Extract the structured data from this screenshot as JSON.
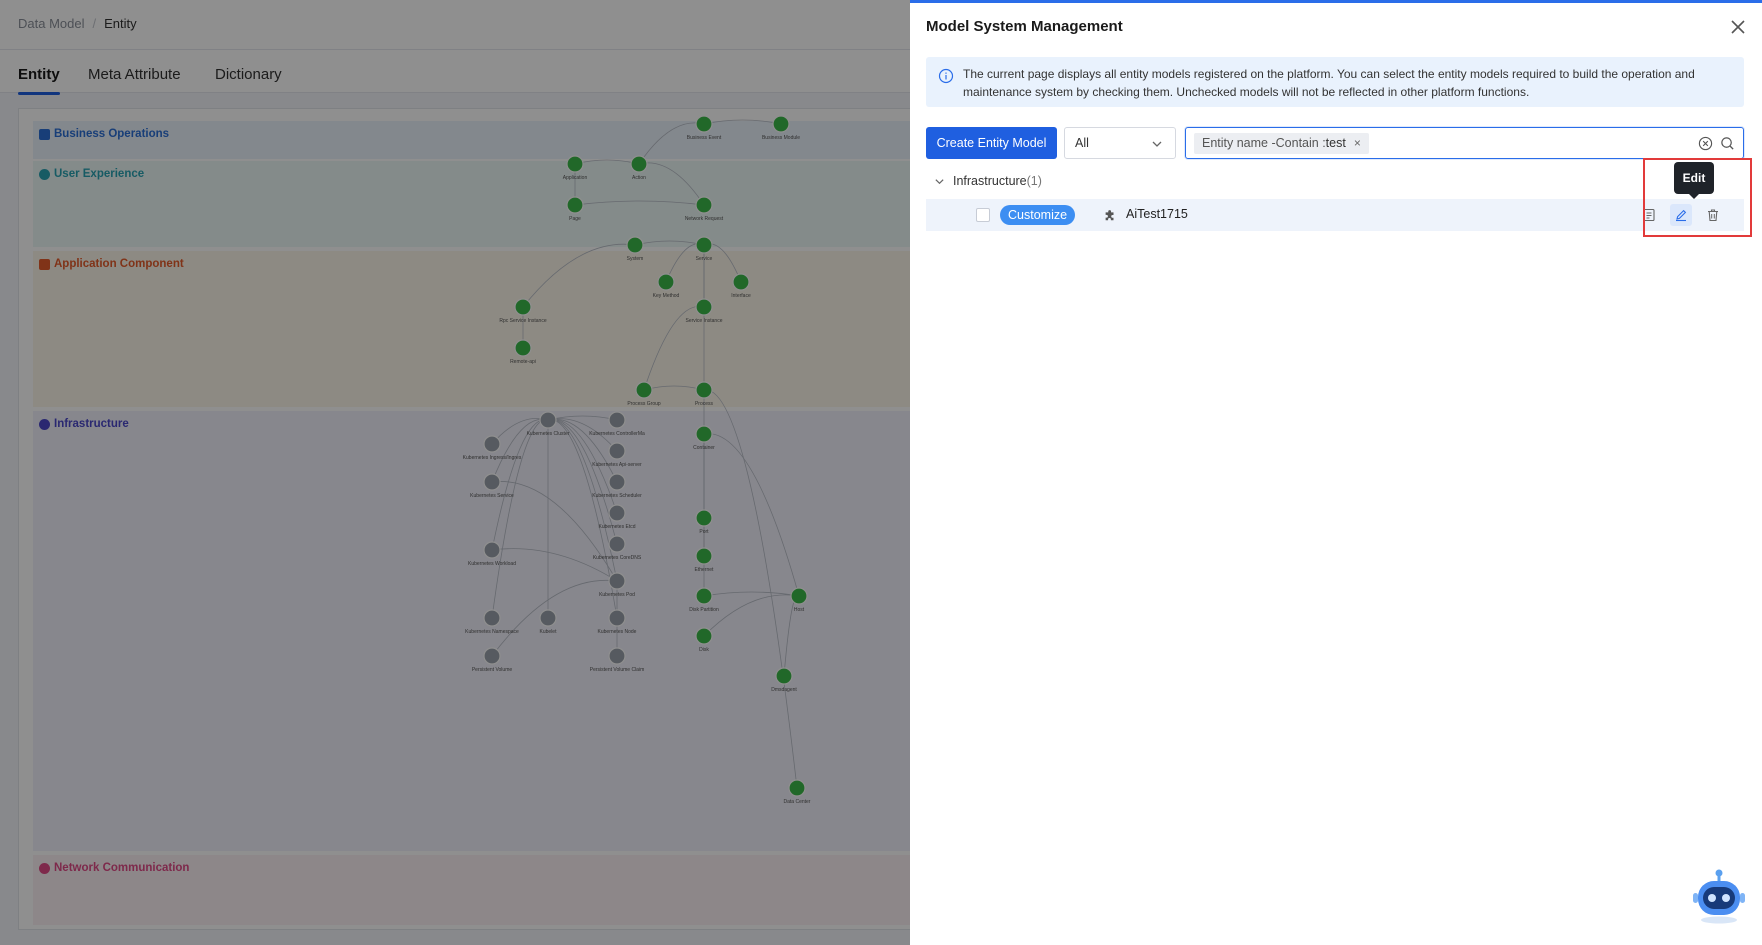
{
  "breadcrumb": [
    "Data Model",
    "Entity"
  ],
  "tabs": [
    {
      "label": "Entity",
      "active": true
    },
    {
      "label": "Meta Attribute",
      "active": false
    },
    {
      "label": "Dictionary",
      "active": false
    }
  ],
  "layers": [
    {
      "name": "Business Operations",
      "color": "#2c6fd6"
    },
    {
      "name": "User Experience",
      "color": "#2aa2b3"
    },
    {
      "name": "Application Component",
      "color": "#e55b2b"
    },
    {
      "name": "Infrastructure",
      "color": "#4b48c9"
    },
    {
      "name": "Network Communication",
      "color": "#e04a86"
    }
  ],
  "graph_nodes": [
    {
      "label": "Business Event"
    },
    {
      "label": "Business Module"
    },
    {
      "label": "Application"
    },
    {
      "label": "Action"
    },
    {
      "label": "Page"
    },
    {
      "label": "Network Request"
    },
    {
      "label": "System"
    },
    {
      "label": "Service"
    },
    {
      "label": "Key Method"
    },
    {
      "label": "Interface"
    },
    {
      "label": "Rpc Service Instance"
    },
    {
      "label": "Service Instance"
    },
    {
      "label": "Remote-api"
    },
    {
      "label": "Process Group"
    },
    {
      "label": "Process"
    },
    {
      "label": "Container"
    },
    {
      "label": "Kubernetes Cluster"
    },
    {
      "label": "Kubernetes ControllerMa"
    },
    {
      "label": "Kubernetes Ingress/Ingres"
    },
    {
      "label": "Kubernetes Api-server"
    },
    {
      "label": "Kubernetes Service"
    },
    {
      "label": "Kubernetes Scheduler"
    },
    {
      "label": "Kubernetes Etcd"
    },
    {
      "label": "Kubernetes Workload"
    },
    {
      "label": "Kubernetes CoreDNS"
    },
    {
      "label": "Kubernetes Pod"
    },
    {
      "label": "Kubernetes Namespace"
    },
    {
      "label": "Kubelet"
    },
    {
      "label": "Kubernetes Node"
    },
    {
      "label": "Persistent Volume"
    },
    {
      "label": "Persistent Volume Claim"
    },
    {
      "label": "Port"
    },
    {
      "label": "Ethernet"
    },
    {
      "label": "Disk Partition"
    },
    {
      "label": "Host"
    },
    {
      "label": "Disk"
    },
    {
      "label": "Dmsdagent"
    },
    {
      "label": "Data Center"
    }
  ],
  "drawer": {
    "title": "Model System Management",
    "info": "The current page displays all entity models registered on the platform. You can select the entity models required to build the operation and maintenance system by checking them. Unchecked models will not be reflected in other platform functions.",
    "create_button": "Create Entity Model",
    "filter_select": "All",
    "search_chip": {
      "label": "Entity name -Contain :",
      "value": "test",
      "remove": "×"
    },
    "group": {
      "name": "Infrastructure",
      "count": "(1)"
    },
    "rows": [
      {
        "tag": "Customize",
        "name": "AiTest1715"
      }
    ],
    "tooltip": "Edit"
  },
  "colors": {
    "primary": "#1f5fe0",
    "tag": "#3d8ef2",
    "info_bg": "#e9f2fd",
    "highlight": "#e23a3a",
    "node_green": "#3bb94a"
  }
}
